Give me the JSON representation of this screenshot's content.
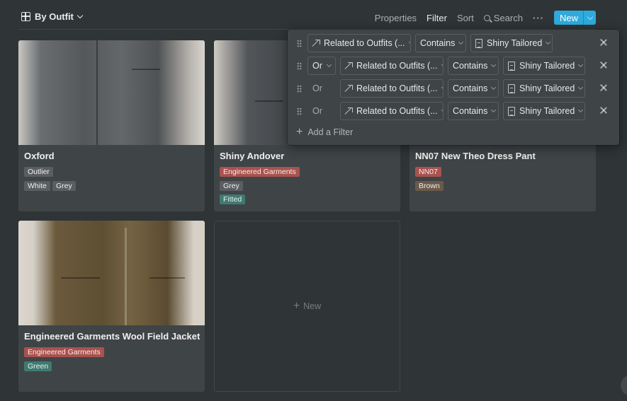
{
  "toolbar": {
    "view_label": "By Outfit",
    "properties": "Properties",
    "filter": "Filter",
    "sort": "Sort",
    "search": "Search",
    "more": "···",
    "new": "New"
  },
  "cards": [
    {
      "title": "Oxford",
      "tags": [
        {
          "text": "Outlier",
          "color": "#5a5e61"
        },
        {
          "text": "White",
          "color": "#5a5e61"
        },
        {
          "text": "Grey",
          "color": "#5a5e61"
        }
      ]
    },
    {
      "title": "Shiny Andover",
      "tags": [
        {
          "text": "Engineered Garments",
          "color": "#a9524e"
        },
        {
          "text": "Grey",
          "color": "#5a5e61"
        },
        {
          "text": "Fitted",
          "color": "#3f7a70"
        }
      ]
    },
    {
      "title": "NN07 New Theo Dress Pant",
      "tags": [
        {
          "text": "NN07",
          "color": "#a9524e"
        },
        {
          "text": "Brown",
          "color": "#6b5a4a"
        }
      ]
    },
    {
      "title": "Engineered Garments Wool Field Jacket",
      "tags": [
        {
          "text": "Engineered Garments",
          "color": "#a9524e"
        },
        {
          "text": "Green",
          "color": "#3f7a70"
        }
      ]
    }
  ],
  "new_card_label": "New",
  "filters": {
    "rows": [
      {
        "conjunction": "",
        "property": "Related to Outfits (...",
        "operator": "Contains",
        "value": "Shiny Tailored"
      },
      {
        "conjunction": "Or",
        "property": "Related to Outfits (...",
        "operator": "Contains",
        "value": "Shiny Tailored"
      },
      {
        "conjunction": "Or",
        "property": "Related to Outfits (...",
        "operator": "Contains",
        "value": "Shiny Tailored"
      },
      {
        "conjunction": "Or",
        "property": "Related to Outfits (...",
        "operator": "Contains",
        "value": "Shiny Tailored"
      }
    ],
    "add_label": "Add a Filter"
  }
}
